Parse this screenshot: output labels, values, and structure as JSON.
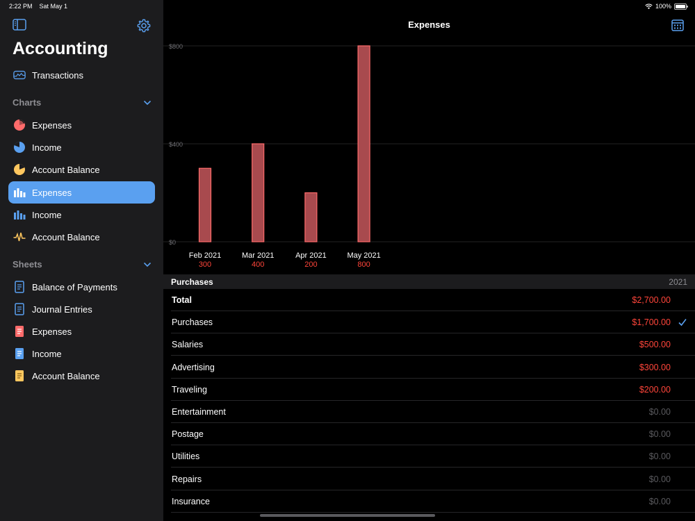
{
  "status_bar": {
    "time": "2:22 PM",
    "date": "Sat May 1",
    "battery": "100%"
  },
  "sidebar": {
    "title": "Accounting",
    "transactions_label": "Transactions",
    "sections": [
      {
        "label": "Charts",
        "items": [
          {
            "label": "Expenses",
            "icon": "pie-chart-icon",
            "color": "#ff6b6b"
          },
          {
            "label": "Income",
            "icon": "pie-chart-icon",
            "color": "#5aa0f0"
          },
          {
            "label": "Account Balance",
            "icon": "pie-chart-icon",
            "color": "#ffc75f"
          },
          {
            "label": "Expenses",
            "icon": "bar-chart-icon",
            "color": "#ffffff",
            "selected": true
          },
          {
            "label": "Income",
            "icon": "bar-chart-icon",
            "color": "#5aa0f0"
          },
          {
            "label": "Account Balance",
            "icon": "waveform-icon",
            "color": "#ffc75f"
          }
        ]
      },
      {
        "label": "Sheets",
        "items": [
          {
            "label": "Balance of Payments",
            "icon": "document-icon",
            "color": "#5aa0f0"
          },
          {
            "label": "Journal Entries",
            "icon": "document-icon",
            "color": "#5aa0f0"
          },
          {
            "label": "Expenses",
            "icon": "document-icon",
            "color": "#ff6b6b"
          },
          {
            "label": "Income",
            "icon": "document-icon",
            "color": "#5aa0f0"
          },
          {
            "label": "Account Balance",
            "icon": "document-icon",
            "color": "#ffc75f"
          }
        ]
      }
    ]
  },
  "main": {
    "title": "Expenses",
    "table": {
      "header": "Purchases",
      "year": "2021",
      "rows": [
        {
          "label": "Total",
          "value": "$2,700.00",
          "bold": true,
          "color": "red"
        },
        {
          "label": "Purchases",
          "value": "$1,700.00",
          "checked": true,
          "color": "red"
        },
        {
          "label": "Salaries",
          "value": "$500.00",
          "color": "red"
        },
        {
          "label": "Advertising",
          "value": "$300.00",
          "color": "red"
        },
        {
          "label": "Traveling",
          "value": "$200.00",
          "color": "red"
        },
        {
          "label": "Entertainment",
          "value": "$0.00",
          "color": "grey"
        },
        {
          "label": "Postage",
          "value": "$0.00",
          "color": "grey"
        },
        {
          "label": "Utilities",
          "value": "$0.00",
          "color": "grey"
        },
        {
          "label": "Repairs",
          "value": "$0.00",
          "color": "grey"
        },
        {
          "label": "Insurance",
          "value": "$0.00",
          "color": "grey"
        }
      ]
    }
  },
  "chart_data": {
    "type": "bar",
    "categories": [
      "Feb 2021",
      "Mar 2021",
      "Apr 2021",
      "May 2021"
    ],
    "values": [
      300,
      400,
      200,
      800
    ],
    "value_labels": [
      "300",
      "400",
      "200",
      "800"
    ],
    "y_ticks": [
      "$0",
      "$400",
      "$800"
    ],
    "ylim": [
      0,
      800
    ],
    "grid": true,
    "bar_color": "#a84a4e",
    "bar_border": "#ff6b6b",
    "value_label_color": "#ff453a"
  },
  "colors": {
    "accent": "#5aa0f0",
    "negative": "#ff453a"
  }
}
